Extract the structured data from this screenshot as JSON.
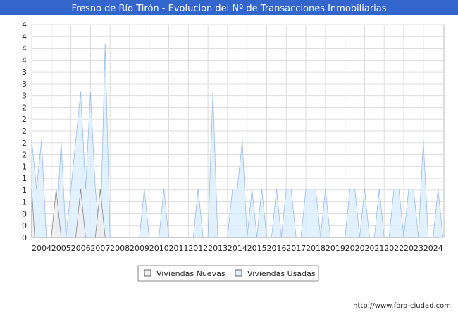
{
  "chart_data": {
    "type": "area",
    "title": "Fresno de Río Tirón - Evolucion del Nº de Transacciones Inmobiliarias",
    "xlabel": "",
    "ylabel": "",
    "x_tick_labels": [
      "2004",
      "2005",
      "2006",
      "2007",
      "2008",
      "2009",
      "2010",
      "2011",
      "2012",
      "2013",
      "2014",
      "2015",
      "2016",
      "2017",
      "2018",
      "2019",
      "2020",
      "2021",
      "2022",
      "2023",
      "2024"
    ],
    "y_tick_labels": [
      "0",
      "0",
      "0",
      "1",
      "1",
      "1",
      "1",
      "2",
      "2",
      "2",
      "2",
      "2",
      "3",
      "3",
      "3",
      "4",
      "4",
      "4",
      "4"
    ],
    "ylim": [
      0,
      4.4
    ],
    "grid": true,
    "legend_position": "bottom",
    "colors": {
      "Viviendas Nuevas": "#eeeeee",
      "Viviendas Usadas": "#ddeeff",
      "usadas_line": "#99bbee",
      "title_bg": "#3366cc"
    },
    "series": [
      {
        "name": "Viviendas Nuevas",
        "points": [
          [
            2004.0,
            1
          ],
          [
            2004.15,
            0
          ],
          [
            2005.0,
            0
          ],
          [
            2005.25,
            1
          ],
          [
            2005.5,
            0
          ],
          [
            2006.25,
            0
          ],
          [
            2006.5,
            1
          ],
          [
            2006.75,
            0
          ],
          [
            2007.25,
            0
          ],
          [
            2007.5,
            1
          ],
          [
            2007.75,
            0
          ],
          [
            2024.75,
            0
          ]
        ]
      },
      {
        "name": "Viviendas Usadas",
        "points": [
          [
            2004.0,
            2
          ],
          [
            2004.25,
            1
          ],
          [
            2004.5,
            2
          ],
          [
            2004.75,
            0
          ],
          [
            2005.25,
            0
          ],
          [
            2005.5,
            2
          ],
          [
            2005.75,
            0
          ],
          [
            2006.0,
            1
          ],
          [
            2006.25,
            2
          ],
          [
            2006.5,
            3
          ],
          [
            2006.75,
            1
          ],
          [
            2007.0,
            3
          ],
          [
            2007.25,
            1
          ],
          [
            2007.5,
            0
          ],
          [
            2007.75,
            4
          ],
          [
            2008.0,
            0
          ],
          [
            2009.5,
            0
          ],
          [
            2009.75,
            1
          ],
          [
            2010.0,
            0
          ],
          [
            2010.5,
            0
          ],
          [
            2010.75,
            1
          ],
          [
            2011.0,
            0
          ],
          [
            2012.25,
            0
          ],
          [
            2012.5,
            1
          ],
          [
            2012.75,
            0
          ],
          [
            2013.0,
            0
          ],
          [
            2013.25,
            3
          ],
          [
            2013.5,
            0
          ],
          [
            2014.0,
            0
          ],
          [
            2014.25,
            1
          ],
          [
            2014.5,
            1
          ],
          [
            2014.75,
            2
          ],
          [
            2015.0,
            0
          ],
          [
            2015.25,
            1
          ],
          [
            2015.5,
            0
          ],
          [
            2015.75,
            1
          ],
          [
            2016.0,
            0
          ],
          [
            2016.25,
            0
          ],
          [
            2016.5,
            1
          ],
          [
            2016.75,
            0
          ],
          [
            2017.0,
            1
          ],
          [
            2017.25,
            1
          ],
          [
            2017.5,
            0
          ],
          [
            2017.75,
            0
          ],
          [
            2018.0,
            1
          ],
          [
            2018.25,
            1
          ],
          [
            2018.5,
            1
          ],
          [
            2018.75,
            0
          ],
          [
            2019.0,
            1
          ],
          [
            2019.25,
            0
          ],
          [
            2020.0,
            0
          ],
          [
            2020.25,
            1
          ],
          [
            2020.5,
            1
          ],
          [
            2020.75,
            0
          ],
          [
            2021.0,
            1
          ],
          [
            2021.25,
            0
          ],
          [
            2021.5,
            0
          ],
          [
            2021.75,
            1
          ],
          [
            2022.0,
            0
          ],
          [
            2022.25,
            0
          ],
          [
            2022.5,
            1
          ],
          [
            2022.75,
            1
          ],
          [
            2023.0,
            0
          ],
          [
            2023.25,
            1
          ],
          [
            2023.5,
            1
          ],
          [
            2023.75,
            0
          ],
          [
            2024.0,
            2
          ],
          [
            2024.25,
            0
          ],
          [
            2024.5,
            0
          ],
          [
            2024.75,
            1
          ],
          [
            2025.0,
            0
          ]
        ]
      }
    ]
  },
  "legend": {
    "items": [
      "Viviendas Nuevas",
      "Viviendas Usadas"
    ]
  },
  "footer": {
    "source": "http://www.foro-ciudad.com"
  }
}
